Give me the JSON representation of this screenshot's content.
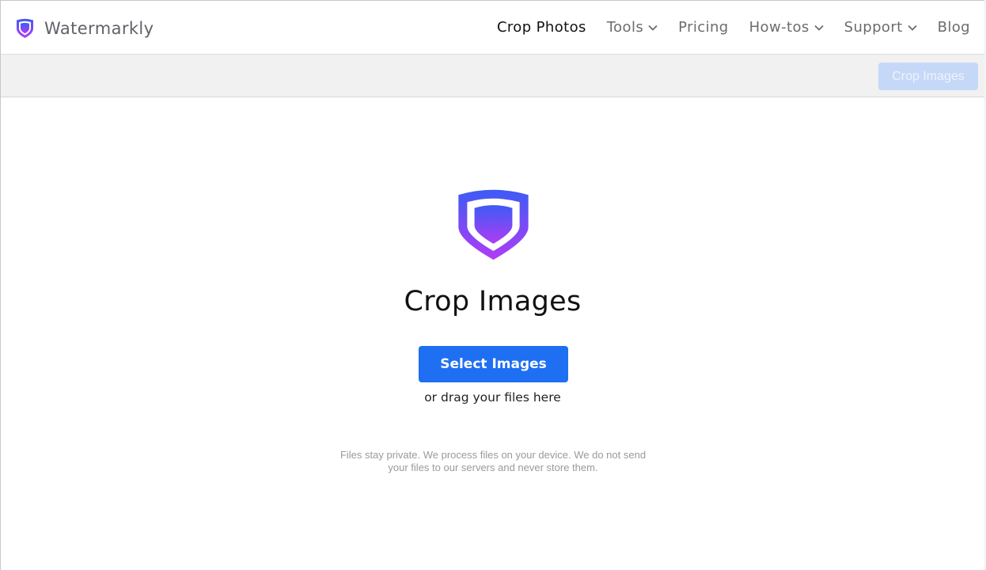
{
  "header": {
    "brand_name": "Watermarkly",
    "brand_icon": "shield-logo-icon",
    "nav": [
      {
        "label": "Crop Photos",
        "active": true,
        "dropdown": false
      },
      {
        "label": "Tools",
        "active": false,
        "dropdown": true
      },
      {
        "label": "Pricing",
        "active": false,
        "dropdown": false
      },
      {
        "label": "How-tos",
        "active": false,
        "dropdown": true
      },
      {
        "label": "Support",
        "active": false,
        "dropdown": true
      },
      {
        "label": "Blog",
        "active": false,
        "dropdown": false
      }
    ]
  },
  "toolbar": {
    "action_label": "Crop Images",
    "action_enabled": false
  },
  "main": {
    "icon": "shield-logo-icon",
    "title": "Crop Images",
    "select_button_label": "Select Images",
    "drag_hint": "or drag your files here",
    "privacy_note": "Files stay private. We process files on your device. We do not send your files to our servers and never store them."
  },
  "colors": {
    "primary": "#1e6ff2",
    "primary_disabled": "#c6d8f7",
    "logo_gradient_top": "#3d5bf5",
    "logo_gradient_bottom": "#b03cf5",
    "nav_text": "#6c6c70",
    "nav_active": "#111111"
  }
}
